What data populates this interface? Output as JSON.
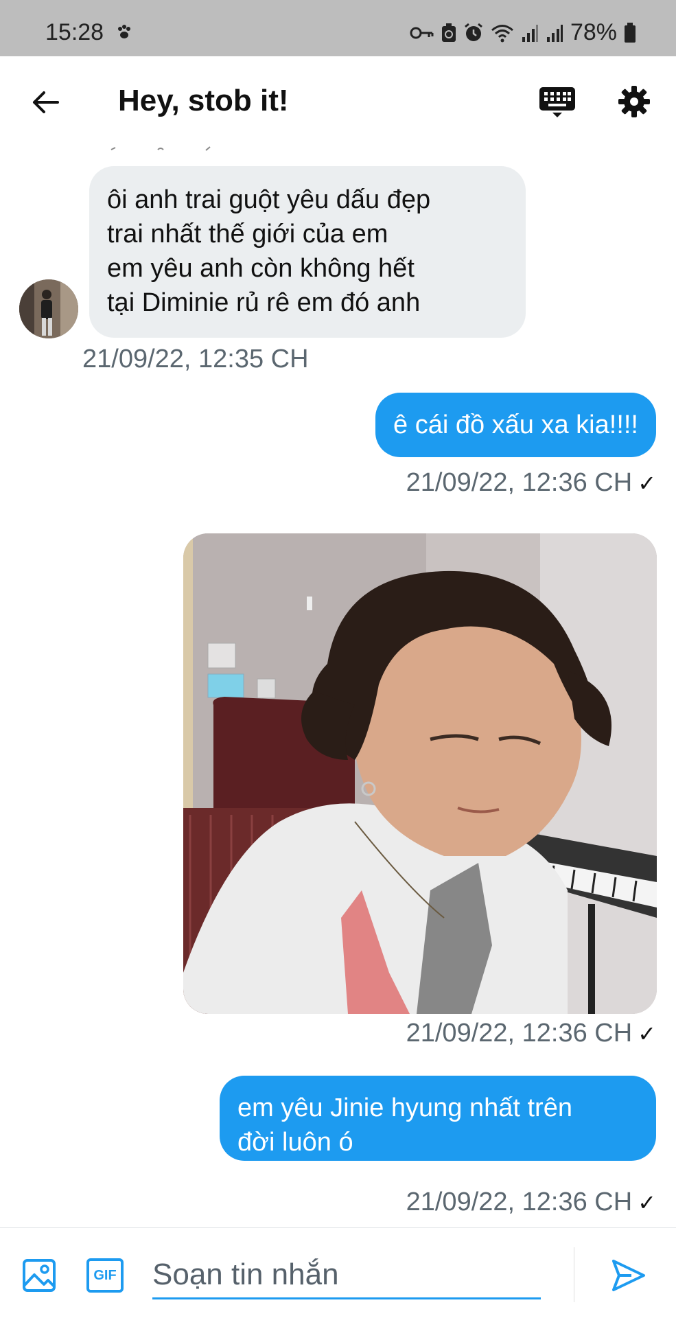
{
  "status_bar": {
    "time": "15:28",
    "battery": "78%",
    "icons": [
      "paw-icon",
      "key-icon",
      "recycle-icon",
      "alarm-icon",
      "wifi-icon",
      "signal-icon",
      "signal-icon",
      "battery-icon"
    ]
  },
  "header": {
    "title": "Hey, stob it!",
    "icons": [
      "back-arrow-icon",
      "keyboard-icon",
      "gear-icon"
    ]
  },
  "messages": [
    {
      "direction": "incoming",
      "lines": [
        "ôi anh trai guột yêu dấu đẹp",
        "trai nhất thế giới của em",
        "em yêu anh còn không hết",
        "tại Diminie rủ rê em đó anh"
      ],
      "timestamp": "21/09/22, 12:35 CH"
    },
    {
      "direction": "outgoing",
      "text": "ê cái đồ xấu xa kia!!!!",
      "timestamp": "21/09/22, 12:36 CH"
    },
    {
      "direction": "outgoing",
      "type": "photo",
      "timestamp": "21/09/22, 12:36 CH"
    },
    {
      "direction": "outgoing",
      "lines": [
        "em yêu Jinie hyung nhất trên",
        "đời luôn ó"
      ],
      "timestamp": "21/09/22, 12:36 CH"
    }
  ],
  "composer": {
    "placeholder": "Soạn tin nhắn",
    "gif_label": "GIF",
    "icons": [
      "image-icon",
      "gif-icon",
      "send-icon"
    ]
  },
  "colors": {
    "accent": "#1d9bf0",
    "incoming_bubble": "#ebeef0",
    "timestamp": "#5b6770",
    "status_bar": "#bdbdbd"
  }
}
